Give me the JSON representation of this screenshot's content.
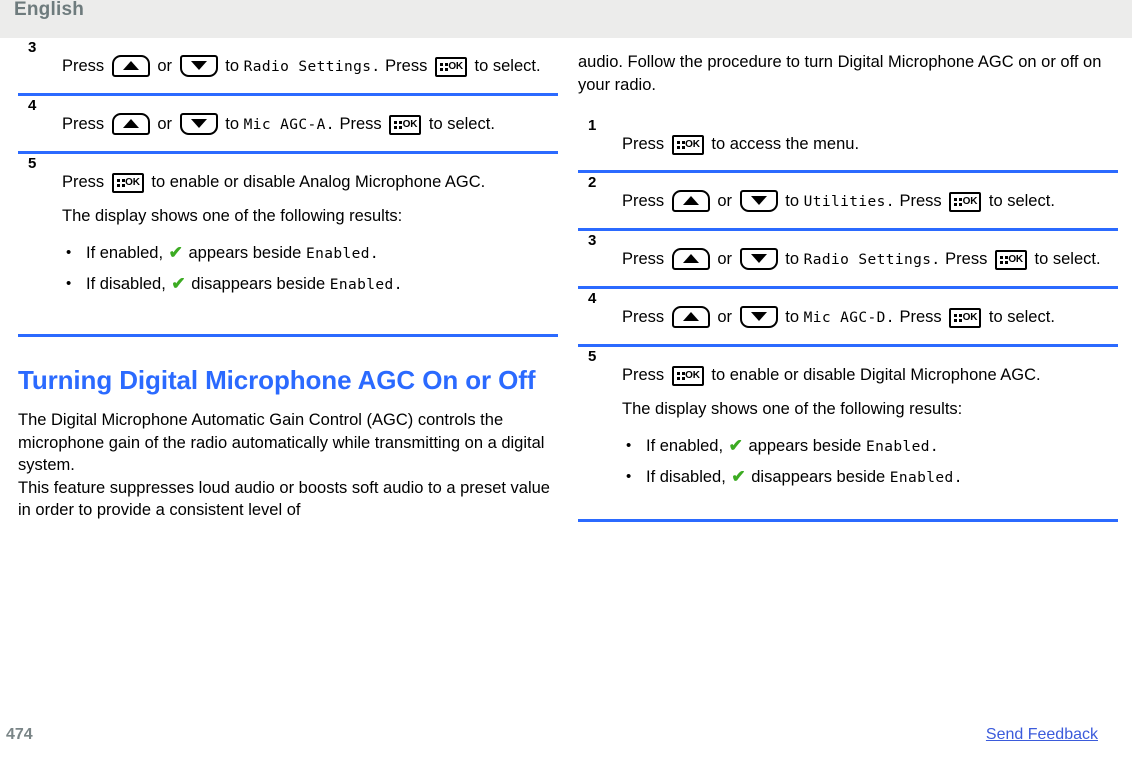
{
  "header": {
    "language": "English"
  },
  "footer": {
    "page_number": "474",
    "feedback_link": "Send Feedback"
  },
  "icons": {
    "ok_key": "ok-key-icon",
    "up_key": "up-arrow-key-icon",
    "down_key": "down-arrow-key-icon",
    "check": "green-checkmark-icon",
    "bullet": "•"
  },
  "colors": {
    "heading": "#2b6aff",
    "rule": "#2b6aff",
    "header_band": "#ececeb",
    "header_text": "#6e7b7d",
    "check_green": "#3cab22",
    "link": "#3b5bdb",
    "page_number": "#7a8587"
  },
  "left_column": {
    "steps": [
      {
        "number": "3",
        "parts": {
          "press_1": "Press",
          "or": "or",
          "to": "to",
          "menu_item": "Radio Settings",
          "period": ".",
          "press_2": "Press",
          "to_select": "to select."
        }
      },
      {
        "number": "4",
        "parts": {
          "press_1": "Press",
          "or": "or",
          "to": "to",
          "menu_item": "Mic AGC-A",
          "period": ".",
          "press_2": "Press",
          "to_select": "to select."
        }
      },
      {
        "number": "5",
        "parts": {
          "press_1": "Press",
          "action": "to enable or disable Analog Microphone AGC.",
          "results_intro": "The display shows one of the following results:"
        },
        "bullets": [
          {
            "prefix": "If enabled,",
            "middle": "appears beside",
            "menu_item": "Enabled",
            "period": "."
          },
          {
            "prefix": "If disabled,",
            "middle": "disappears beside",
            "menu_item": "Enabled",
            "period": "."
          }
        ]
      }
    ],
    "section": {
      "heading": "Turning Digital Microphone AGC On or Off",
      "paragraph_1": "The Digital Microphone Automatic Gain Control (AGC) controls the microphone gain of the radio automatically while transmitting on a digital system.",
      "paragraph_2": "This feature suppresses loud audio or boosts soft audio to a preset value in order to provide a consistent level of"
    }
  },
  "right_column": {
    "continuation": "audio. Follow the procedure to turn Digital Microphone AGC on or off on your radio.",
    "steps": [
      {
        "number": "1",
        "parts": {
          "press_1": "Press",
          "action": "to access the menu."
        }
      },
      {
        "number": "2",
        "parts": {
          "press_1": "Press",
          "or": "or",
          "to": "to",
          "menu_item": "Utilities",
          "period": ".",
          "press_2": "Press",
          "to_select": "to select."
        }
      },
      {
        "number": "3",
        "parts": {
          "press_1": "Press",
          "or": "or",
          "to": "to",
          "menu_item": "Radio Settings",
          "period": ".",
          "press_2": "Press",
          "to_select": "to select."
        }
      },
      {
        "number": "4",
        "parts": {
          "press_1": "Press",
          "or": "or",
          "to": "to",
          "menu_item": "Mic AGC-D",
          "period": ".",
          "press_2": "Press",
          "to_select": "to select."
        }
      },
      {
        "number": "5",
        "parts": {
          "press_1": "Press",
          "action": "to enable or disable Digital Microphone AGC.",
          "results_intro": "The display shows one of the following results:"
        },
        "bullets": [
          {
            "prefix": "If enabled,",
            "middle": "appears beside",
            "menu_item": "Enabled",
            "period": "."
          },
          {
            "prefix": "If disabled,",
            "middle": "disappears beside",
            "menu_item": "Enabled",
            "period": "."
          }
        ]
      }
    ]
  }
}
